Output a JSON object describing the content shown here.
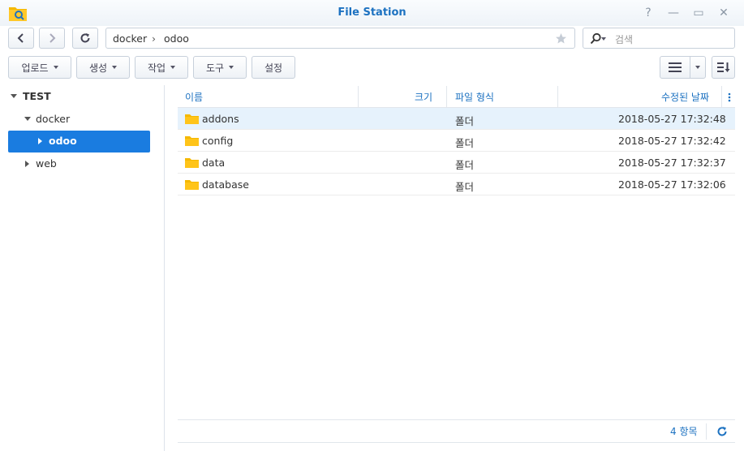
{
  "window": {
    "title": "File Station",
    "help": "?",
    "minimize": "—",
    "maximize": "▭",
    "close": "✕"
  },
  "nav": {
    "back": "‹",
    "forward": "›"
  },
  "address": {
    "crumbs": [
      "docker",
      "odoo"
    ],
    "separator": "›"
  },
  "search": {
    "placeholder": "검색"
  },
  "toolbar": {
    "upload": "업로드",
    "create": "생성",
    "action": "작업",
    "tools": "도구",
    "settings": "설정"
  },
  "tree": {
    "root": "TEST",
    "items": [
      "docker",
      "odoo",
      "web"
    ]
  },
  "columns": {
    "name": "이름",
    "size": "크기",
    "type": "파일 형식",
    "modified": "수정된 날짜"
  },
  "files": [
    {
      "name": "addons",
      "type": "폴더",
      "modified": "2018-05-27 17:32:48"
    },
    {
      "name": "config",
      "type": "폴더",
      "modified": "2018-05-27 17:32:42"
    },
    {
      "name": "data",
      "type": "폴더",
      "modified": "2018-05-27 17:32:37"
    },
    {
      "name": "database",
      "type": "폴더",
      "modified": "2018-05-27 17:32:06"
    }
  ],
  "footer": {
    "count": "4 항목"
  },
  "colors": {
    "accent": "#1a7ce0",
    "title": "#1d72c1",
    "folder": "#f5b800"
  }
}
